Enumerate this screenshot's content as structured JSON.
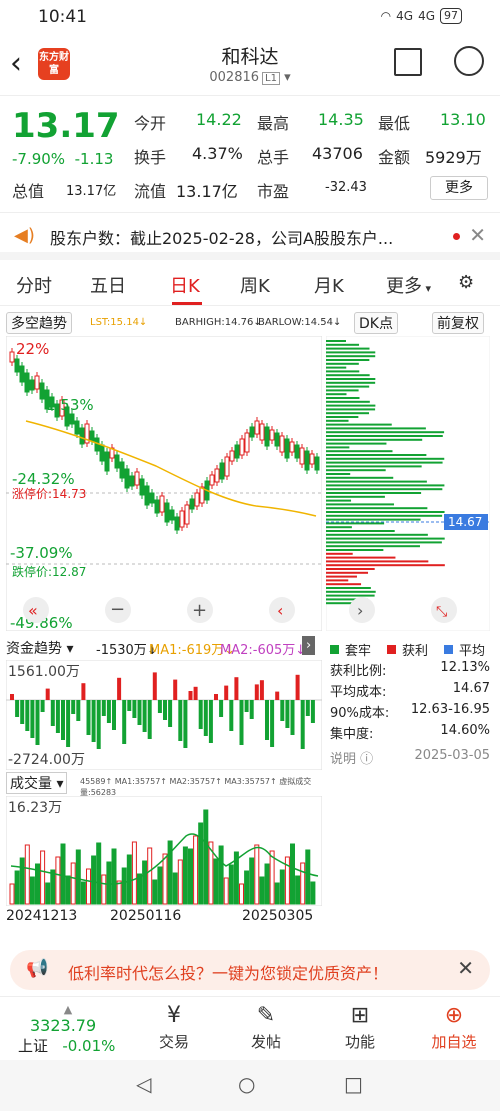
{
  "status": {
    "time": "10:41",
    "signal1": "4G",
    "signal2": "4G",
    "battery": "97"
  },
  "header": {
    "logo": "东方财富",
    "name": "和科达",
    "code": "002816",
    "market": "L1"
  },
  "quote": {
    "price": "13.17",
    "pct": "-7.90%",
    "change": "-1.13",
    "open_label": "今开",
    "open": "14.22",
    "high_label": "最高",
    "high": "14.35",
    "low_label": "最低",
    "low": "13.10",
    "turnover_label": "换手",
    "turnover": "4.37%",
    "volume_label": "总手",
    "volume": "43706",
    "amount_label": "金额",
    "amount": "5929万",
    "mcap_label": "总值",
    "mcap": "13.17亿",
    "float_label": "流值",
    "float": "13.17亿",
    "pe_label": "市盈",
    "pe": "-32.43",
    "more": "更多"
  },
  "notice": {
    "text": "股东户数：截止2025-02-28，公司A股股东户..."
  },
  "tabs": [
    "分时",
    "五日",
    "日K",
    "周K",
    "月K",
    "更多"
  ],
  "active_tab": "日K",
  "kline": {
    "indicator": "多空趋势",
    "lst": "LST:15.14↓",
    "barhigh": "BARHIGH:14.76↓",
    "barlow": "BARLOW:14.54↓",
    "dk_button": "DK点",
    "adjust_button": "前复权",
    "pct_labels": [
      "22%",
      "1.53%",
      "-24.32%",
      "-37.09%",
      "-49.86%"
    ],
    "limit_up": "涨停价:14.73",
    "limit_down": "跌停价:12.87",
    "price_tag": "14.67"
  },
  "chip_legend": {
    "trapped": "套牢",
    "profit": "获利",
    "avg": "平均"
  },
  "chip_stats": {
    "rows": [
      {
        "label": "获利比例:",
        "value": "12.13%"
      },
      {
        "label": "平均成本:",
        "value": "14.67"
      },
      {
        "label": "90%成本:",
        "value": "12.63-16.95"
      },
      {
        "label": "集中度:",
        "value": "14.60%"
      }
    ],
    "note": "说明",
    "date": "2025-03-05"
  },
  "fund": {
    "indicator": "资金趋势",
    "value": "-1530万↓",
    "ma1": "MA1:-619万↓",
    "ma2": "MA2:-605万↓",
    "top": "1561.00万",
    "bottom": "-2724.00万"
  },
  "vol": {
    "indicator": "成交量",
    "line": "45589↑ MA1:35757↑ MA2:35757↑ MA3:35757↑ 虚拟成交量:56283",
    "top": "16.23万"
  },
  "dates": [
    "20241213",
    "20250116",
    "20250305"
  ],
  "ad": {
    "text": "低利率时代怎么投？一键为您锁定优质资产！"
  },
  "bottom": {
    "index_value": "3323.79",
    "index_name": "上证",
    "index_pct": "-0.01%",
    "items": [
      {
        "label": "交易",
        "icon": "yuan-icon"
      },
      {
        "label": "发帖",
        "icon": "edit-icon"
      },
      {
        "label": "功能",
        "icon": "grid-icon"
      },
      {
        "label": "加自选",
        "icon": "plus-circle-icon"
      }
    ]
  },
  "colors": {
    "up": "#e02020",
    "down": "#12a233",
    "accent": "#e64020"
  }
}
